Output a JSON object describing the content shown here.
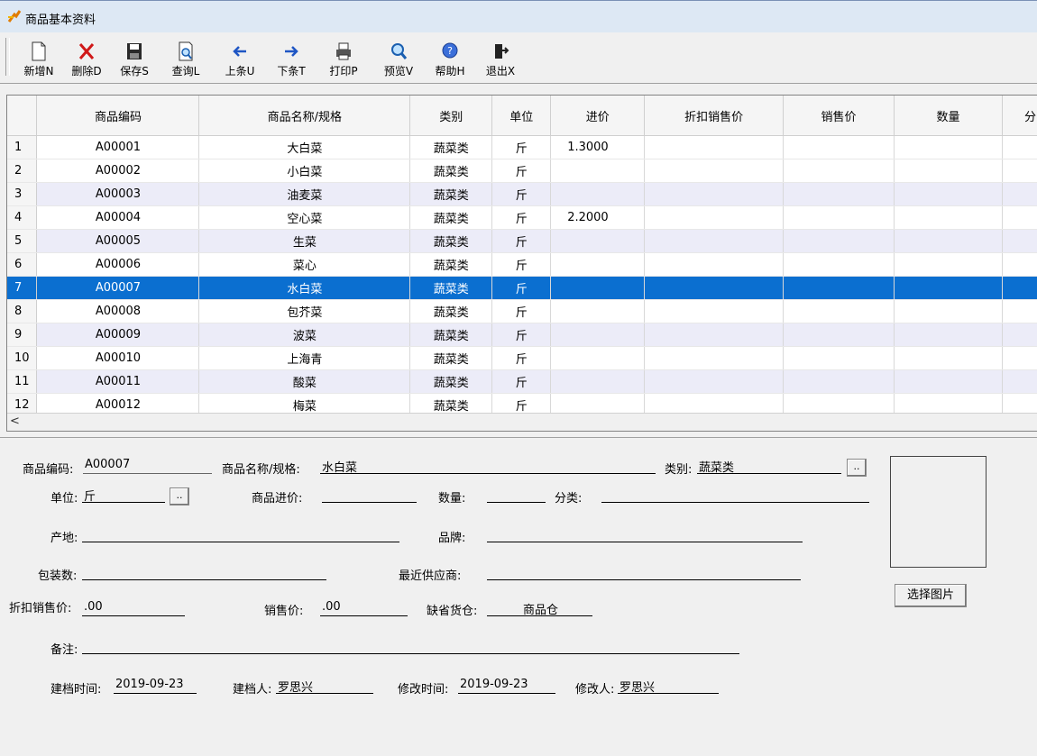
{
  "window": {
    "title": "商品基本资料"
  },
  "toolbar": {
    "buttons": [
      {
        "label": "新增N",
        "icon": "new-document-icon"
      },
      {
        "label": "删除D",
        "icon": "delete-x-icon"
      },
      {
        "label": "保存S",
        "icon": "save-floppy-icon"
      },
      {
        "label": "查询L",
        "icon": "query-magnifier-doc-icon"
      },
      {
        "label": "上条U",
        "icon": "arrow-left-icon"
      },
      {
        "label": "下条T",
        "icon": "arrow-right-icon"
      },
      {
        "label": "打印P",
        "icon": "printer-icon"
      },
      {
        "label": "预览V",
        "icon": "preview-magnifier-icon"
      },
      {
        "label": "帮助H",
        "icon": "help-icon"
      },
      {
        "label": "退出X",
        "icon": "exit-door-icon"
      }
    ]
  },
  "grid": {
    "columns": [
      "商品编码",
      "商品名称/规格",
      "类别",
      "单位",
      "进价",
      "折扣销售价",
      "销售价",
      "数量",
      "分"
    ],
    "rows": [
      {
        "n": "1",
        "code": "A00001",
        "name": "大白菜",
        "cat": "蔬菜类",
        "unit": "斤",
        "price": "1.3000"
      },
      {
        "n": "2",
        "code": "A00002",
        "name": "小白菜",
        "cat": "蔬菜类",
        "unit": "斤",
        "price": ""
      },
      {
        "n": "3",
        "code": "A00003",
        "name": "油麦菜",
        "cat": "蔬菜类",
        "unit": "斤",
        "price": ""
      },
      {
        "n": "4",
        "code": "A00004",
        "name": "空心菜",
        "cat": "蔬菜类",
        "unit": "斤",
        "price": "2.2000"
      },
      {
        "n": "5",
        "code": "A00005",
        "name": "生菜",
        "cat": "蔬菜类",
        "unit": "斤",
        "price": ""
      },
      {
        "n": "6",
        "code": "A00006",
        "name": "菜心",
        "cat": "蔬菜类",
        "unit": "斤",
        "price": ""
      },
      {
        "n": "7",
        "code": "A00007",
        "name": "水白菜",
        "cat": "蔬菜类",
        "unit": "斤",
        "price": ""
      },
      {
        "n": "8",
        "code": "A00008",
        "name": "包芥菜",
        "cat": "蔬菜类",
        "unit": "斤",
        "price": ""
      },
      {
        "n": "9",
        "code": "A00009",
        "name": "波菜",
        "cat": "蔬菜类",
        "unit": "斤",
        "price": ""
      },
      {
        "n": "10",
        "code": "A00010",
        "name": "上海青",
        "cat": "蔬菜类",
        "unit": "斤",
        "price": ""
      },
      {
        "n": "11",
        "code": "A00011",
        "name": "酸菜",
        "cat": "蔬菜类",
        "unit": "斤",
        "price": ""
      },
      {
        "n": "12",
        "code": "A00012",
        "name": "梅菜",
        "cat": "蔬菜类",
        "unit": "斤",
        "price": ""
      }
    ],
    "selected_row": "7",
    "scroll_left_arrow": "<"
  },
  "form": {
    "code_label": "商品编码:",
    "code_value": "A00007",
    "name_label": "商品名称/规格:",
    "name_value": "水白菜",
    "category_label": "类别:",
    "category_value": "蔬菜类",
    "unit_label": "单位:",
    "unit_value": "斤",
    "cost_label": "商品进价:",
    "cost_value": "",
    "qty_label": "数量:",
    "qty_value": "",
    "class_label": "分类:",
    "class_value": "",
    "origin_label": "产地:",
    "origin_value": "",
    "brand_label": "品牌:",
    "brand_value": "",
    "pack_label": "包装数:",
    "pack_value": "",
    "supplier_label": "最近供应商:",
    "supplier_value": "",
    "discount_label": "折扣销售价:",
    "discount_value": ".00",
    "sale_label": "销售价:",
    "sale_value": ".00",
    "warehouse_label": "缺省货仓:",
    "warehouse_value": "商品仓",
    "remark_label": "备注:",
    "remark_value": "",
    "created_label": "建档时间:",
    "created_value": "2019-09-23",
    "creator_label": "建档人:",
    "creator_value": "罗思兴",
    "modified_label": "修改时间:",
    "modified_value": "2019-09-23",
    "modifier_label": "修改人:",
    "modifier_value": "罗思兴",
    "dots": "..",
    "choose_image": "选择图片"
  }
}
